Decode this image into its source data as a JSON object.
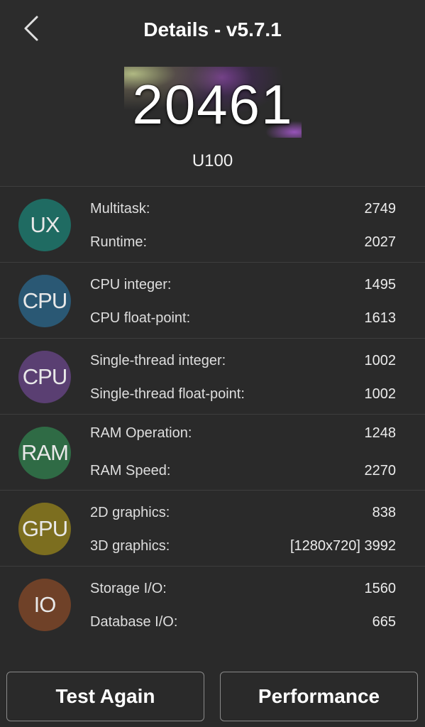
{
  "header": {
    "title": "Details - v5.7.1",
    "score": "20461",
    "device": "U100"
  },
  "categories": [
    {
      "badge": "UX",
      "color": "#1f6b62",
      "items": [
        {
          "label": "Multitask:",
          "value": "2749"
        },
        {
          "label": "Runtime:",
          "value": "2027"
        }
      ]
    },
    {
      "badge": "CPU",
      "color": "#2a5874",
      "items": [
        {
          "label": "CPU integer:",
          "value": "1495"
        },
        {
          "label": "CPU float-point:",
          "value": "1613"
        }
      ]
    },
    {
      "badge": "CPU",
      "color": "#5a3f72",
      "items": [
        {
          "label": "Single-thread integer:",
          "value": "1002"
        },
        {
          "label": "Single-thread float-point:",
          "value": "1002"
        }
      ]
    },
    {
      "badge": "RAM",
      "color": "#2f6b45",
      "items": [
        {
          "label": "RAM Operation:",
          "value": "1248"
        },
        {
          "label": "RAM Speed:",
          "value": "2270"
        }
      ]
    },
    {
      "badge": "GPU",
      "color": "#7c6e1f",
      "items": [
        {
          "label": "2D graphics:",
          "value": "838"
        },
        {
          "label": "3D graphics:",
          "value": "[1280x720] 3992"
        }
      ]
    },
    {
      "badge": "IO",
      "color": "#6f4128",
      "items": [
        {
          "label": "Storage I/O:",
          "value": "1560"
        },
        {
          "label": "Database I/O:",
          "value": "665"
        }
      ]
    }
  ],
  "buttons": {
    "test_again": "Test Again",
    "performance": "Performance"
  }
}
